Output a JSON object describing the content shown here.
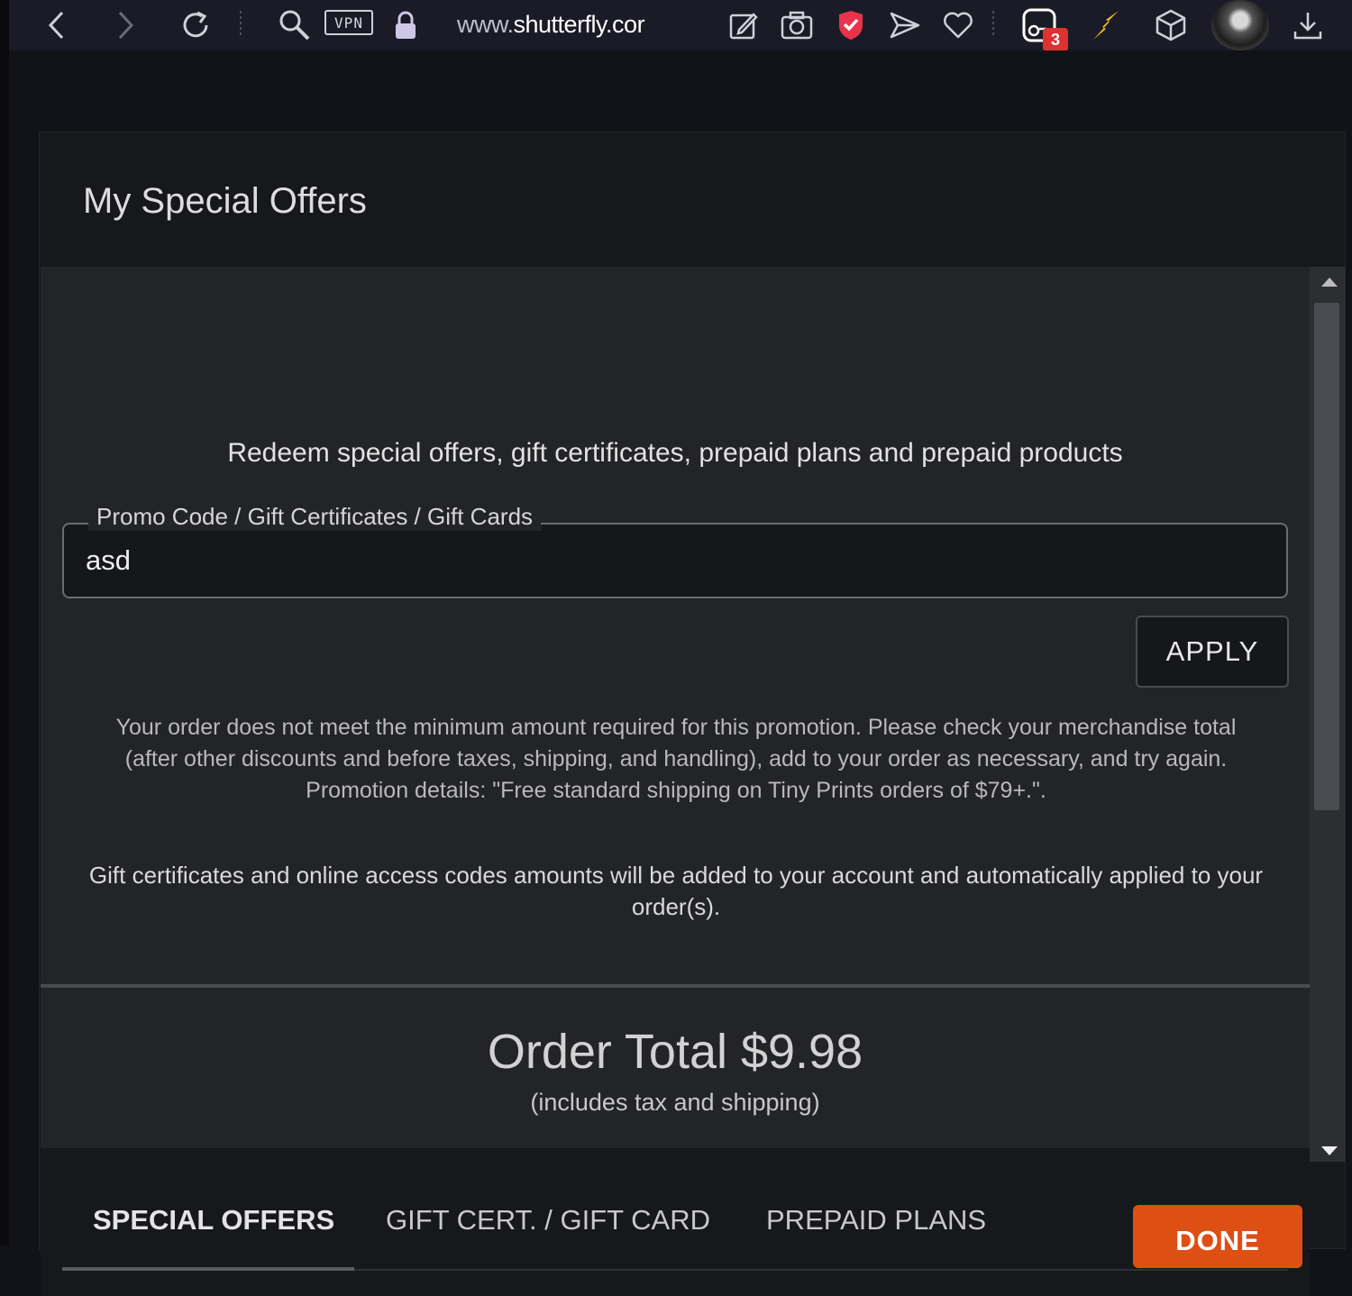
{
  "browser": {
    "vpn_label": "VPN",
    "url_prefix": "www.",
    "url_host": "shutterfly.cor",
    "notification_count": "3",
    "icons": [
      "back-icon",
      "forward-icon",
      "reload-icon",
      "search-icon",
      "lock-icon",
      "edit-icon",
      "camera-icon",
      "shield-icon",
      "send-icon",
      "heart-icon",
      "extensions-icon",
      "bolt-icon",
      "box-icon",
      "avatar",
      "download-icon"
    ]
  },
  "modal": {
    "title": "My Special Offers",
    "lead": "Redeem special offers, gift certificates, prepaid plans and prepaid products",
    "promo_field": {
      "label": "Promo Code / Gift Certificates / Gift Cards",
      "value": "asd"
    },
    "apply_label": "APPLY",
    "error_message": "Your order does not meet the minimum amount required for this promotion. Please check your merchandise total (after other discounts and before taxes, shipping, and handling), add to your order as necessary, and try again. Promotion details: \"Free standard shipping on Tiny Prints orders of $79+.\".",
    "info_message": "Gift certificates and online access codes amounts will be added to your account and automatically applied to your order(s).",
    "order_total": "Order Total $9.98",
    "order_total_note": "(includes tax and shipping)",
    "tabs": [
      {
        "label": "SPECIAL OFFERS",
        "active": true
      },
      {
        "label": "GIFT CERT. / GIFT CARD",
        "active": false
      },
      {
        "label": "PREPAID PLANS",
        "active": false
      }
    ],
    "done_label": "DONE"
  },
  "colors": {
    "accent": "#de4f13",
    "badge": "#e03131",
    "shield": "#e8334a",
    "bolt": "#f0c419"
  }
}
